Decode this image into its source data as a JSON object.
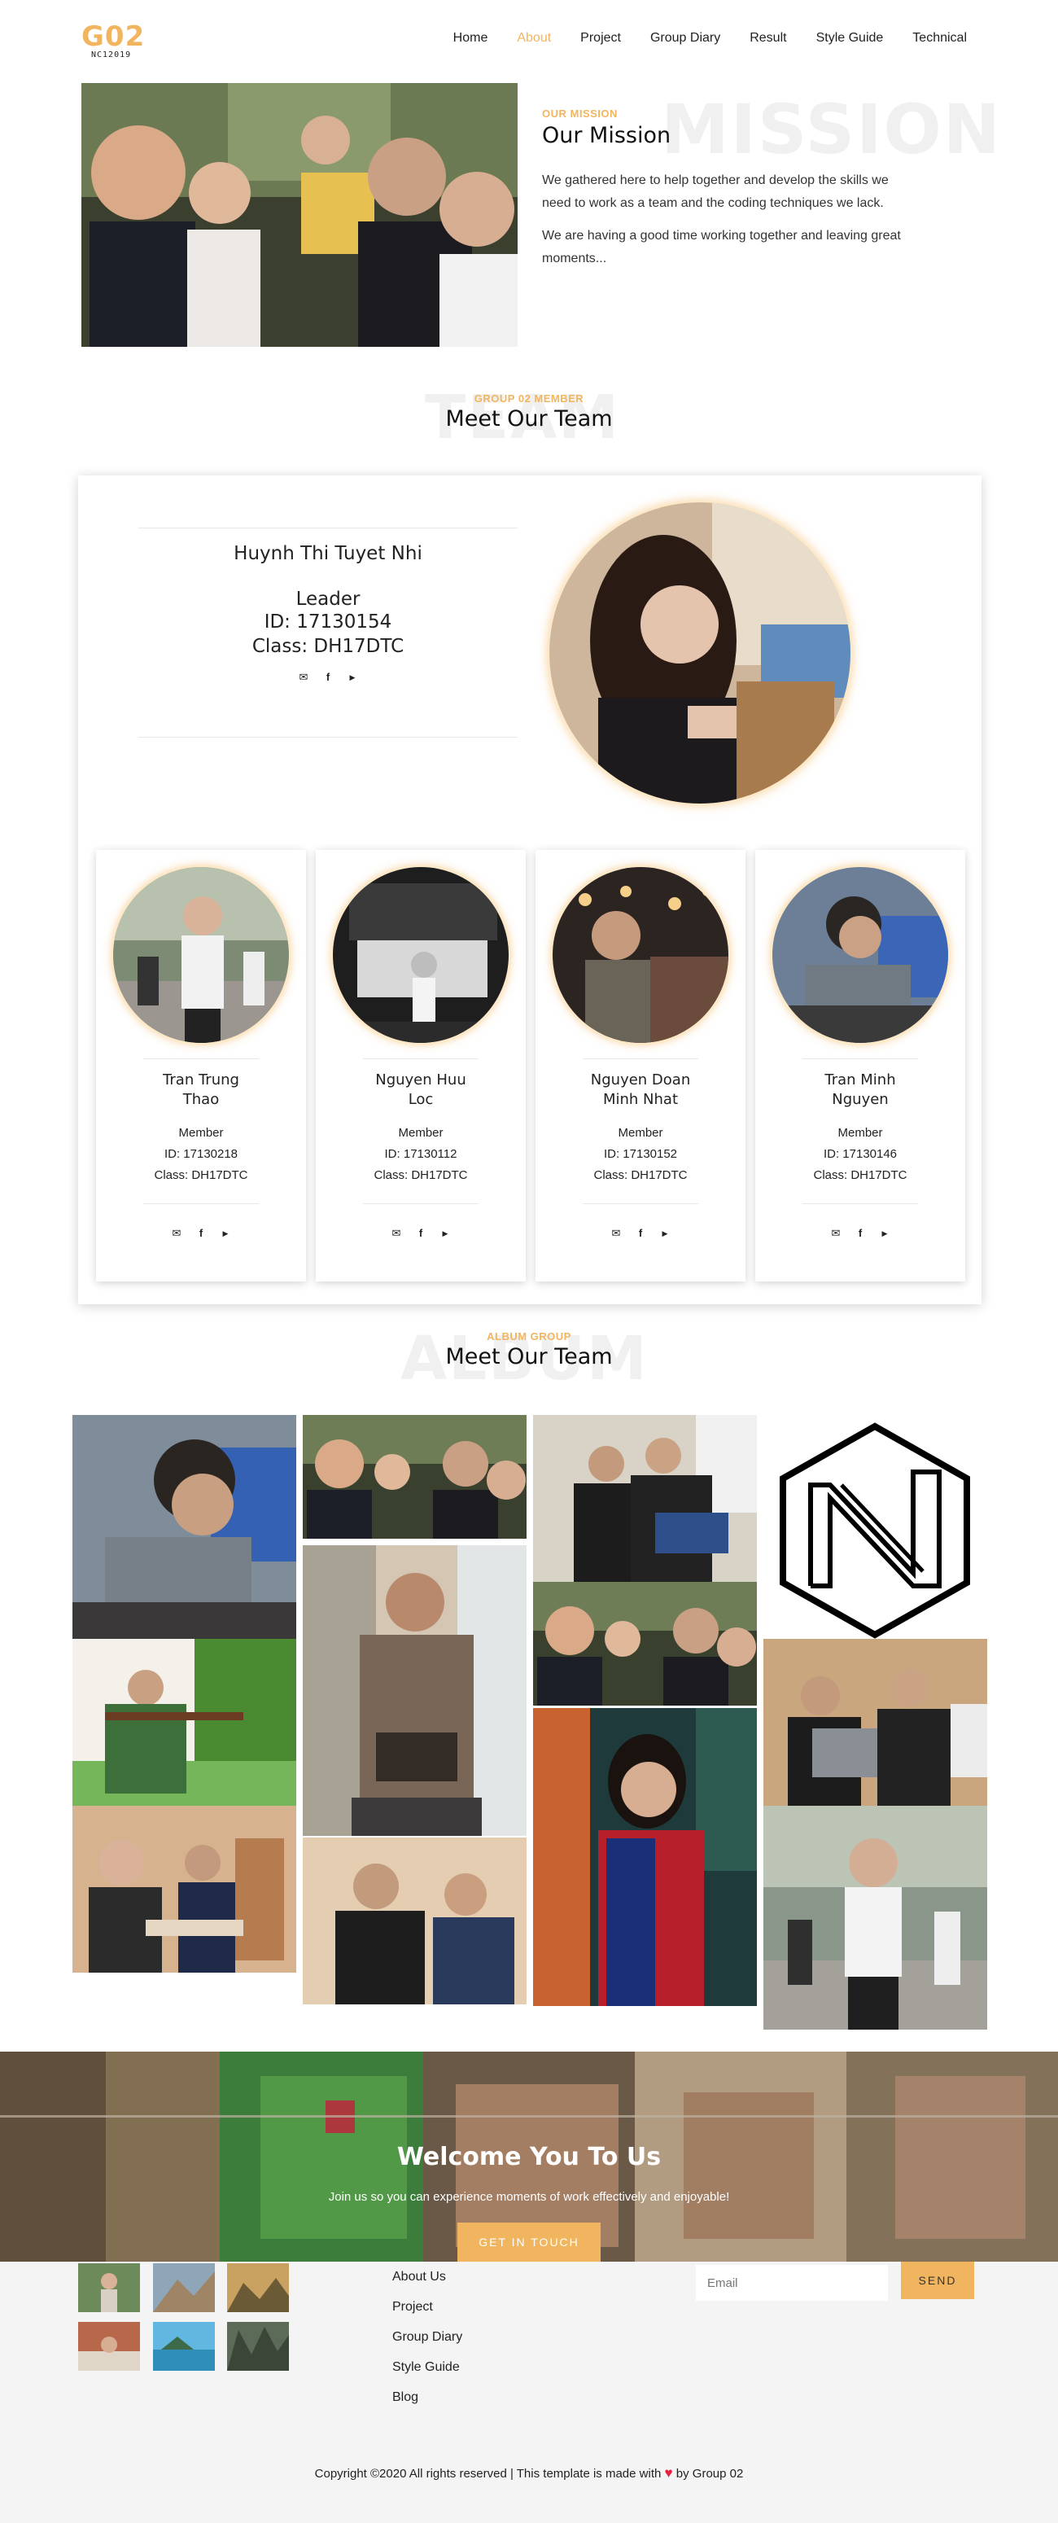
{
  "header": {
    "logo_main": "G02",
    "logo_sub": "NC12019",
    "nav": [
      {
        "label": "Home",
        "active": false
      },
      {
        "label": "About",
        "active": true
      },
      {
        "label": "Project",
        "active": false
      },
      {
        "label": "Group Diary",
        "active": false
      },
      {
        "label": "Result",
        "active": false
      },
      {
        "label": "Style Guide",
        "active": false
      },
      {
        "label": "Technical",
        "active": false
      }
    ]
  },
  "mission": {
    "ghost": "MISSION",
    "eyebrow": "OUR MISSION",
    "title": "Our Mission",
    "para1": "We gathered here to help together and develop the skills we need to work as a team and the coding techniques we lack.",
    "para2": "We are having a good time working together and leaving great moments..."
  },
  "team": {
    "ghost": "TEAM",
    "eyebrow": "GROUP 02 MEMBER",
    "title": "Meet Our Team",
    "leader": {
      "name": "Huynh Thi Tuyet Nhi",
      "role": "Leader",
      "id": "ID: 17130154",
      "class": "Class: DH17DTC"
    },
    "members": [
      {
        "name": "Tran Trung Thao",
        "role": "Member",
        "id": "ID: 17130218",
        "class": "Class: DH17DTC"
      },
      {
        "name": "Nguyen Huu Loc",
        "role": "Member",
        "id": "ID: 17130112",
        "class": "Class: DH17DTC"
      },
      {
        "name": "Nguyen Doan Minh Nhat",
        "role": "Member",
        "id": "ID: 17130152",
        "class": "Class: DH17DTC"
      },
      {
        "name": "Tran Minh Nguyen",
        "role": "Member",
        "id": "ID: 17130146",
        "class": "Class: DH17DTC"
      }
    ],
    "icons": [
      "email-icon",
      "facebook-icon",
      "youtube-icon"
    ]
  },
  "album": {
    "ghost": "ALBUM",
    "eyebrow": "ALBUM GROUP",
    "title": "Meet Our Team"
  },
  "banner": {
    "title": "Welcome You To Us",
    "subtitle": "Join us so you can experience moments of work effectively and enjoyable!",
    "button": "GET IN TOUCH"
  },
  "footer": {
    "links": [
      "About Us",
      "Project",
      "Group Diary",
      "Style Guide",
      "Blog"
    ],
    "email_placeholder": "Email",
    "send": "SEND",
    "copyright_before": "Copyright ©2020 All rights reserved | This template is made with",
    "heart": "♥",
    "copyright_after": "by Group 02"
  },
  "colors": {
    "accent": "#f2b55f",
    "heart": "#e2213f",
    "footer_bg": "#f4f4f4"
  }
}
